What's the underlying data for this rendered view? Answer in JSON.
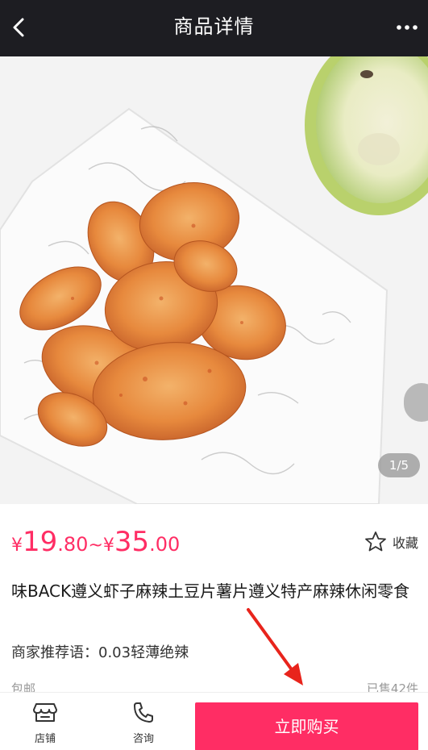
{
  "header": {
    "title": "商品详情",
    "back_icon": "chevron-left-icon",
    "more_icon": "more-dots-icon"
  },
  "gallery": {
    "page_indicator": "1/5",
    "image_subject": "spicy potato chips on paper"
  },
  "price": {
    "currency": "¥",
    "low_int": "19",
    "low_dec": ".80",
    "separator": "~",
    "high_int": "35",
    "high_dec": ".00",
    "color": "#ff2d64"
  },
  "favorite": {
    "label": "收藏",
    "icon": "star-outline-icon"
  },
  "product": {
    "title": "味BACK遵义虾子麻辣土豆片薯片遵义特产麻辣休闲零食",
    "recommend": "商家推荐语：0.03轻薄绝辣",
    "shipping": "包邮",
    "sold": "已售42件"
  },
  "bottom_bar": {
    "store_label": "店铺",
    "store_icon": "store-icon",
    "consult_label": "咨询",
    "consult_icon": "phone-icon",
    "buy_label": "立即购买",
    "buy_color": "#ff2d64"
  },
  "annotation": {
    "arrow_color": "#e8241c"
  }
}
